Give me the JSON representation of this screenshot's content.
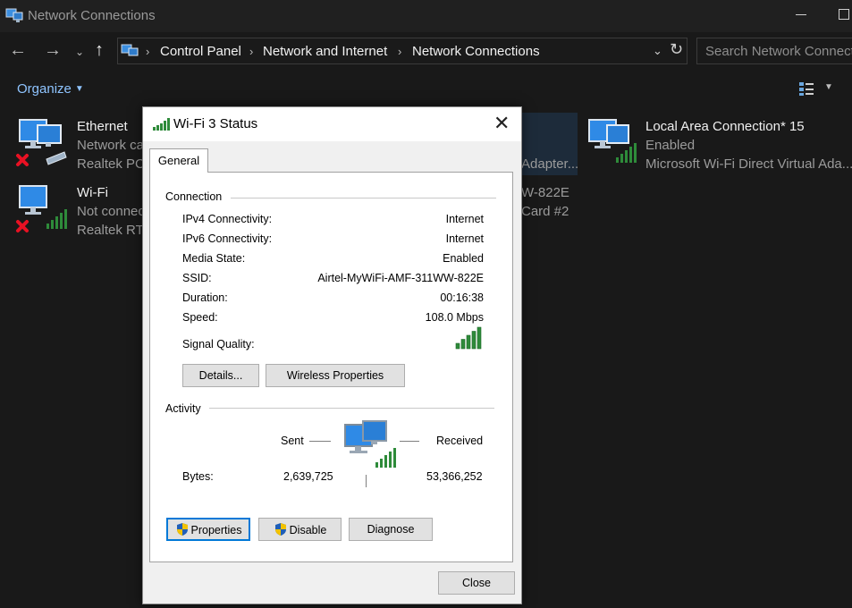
{
  "window": {
    "title": "Network Connections"
  },
  "address": {
    "crumbs": [
      "Control Panel",
      "Network and Internet",
      "Network Connections"
    ],
    "search_placeholder": "Search Network Connections"
  },
  "toolbar": {
    "organize_label": "Organize"
  },
  "connections": [
    {
      "name": "Ethernet",
      "status": "Network ca",
      "device": "Realtek PCI",
      "state": "disconnected"
    },
    {
      "name": "Wi-Fi",
      "status": "Not connec",
      "device": "Realtek RTL",
      "state": "disconnected"
    },
    {
      "name": "",
      "status": "",
      "device": "Adapter...",
      "state": "selected"
    },
    {
      "name": "",
      "status": "W-822E",
      "device": "Card #2",
      "state": "partial"
    },
    {
      "name": "Local Area Connection* 15",
      "status": "Enabled",
      "device": "Microsoft Wi-Fi Direct Virtual Ada...",
      "state": "enabled"
    }
  ],
  "dialog": {
    "title": "Wi-Fi 3 Status",
    "tab_label": "General",
    "connection_group": "Connection",
    "rows": [
      {
        "label": "IPv4 Connectivity:",
        "value": "Internet"
      },
      {
        "label": "IPv6 Connectivity:",
        "value": "Internet"
      },
      {
        "label": "Media State:",
        "value": "Enabled"
      },
      {
        "label": "SSID:",
        "value": "Airtel-MyWiFi-AMF-311WW-822E"
      },
      {
        "label": "Duration:",
        "value": "00:16:38"
      },
      {
        "label": "Speed:",
        "value": "108.0 Mbps"
      }
    ],
    "signal_label": "Signal Quality:",
    "signal_bars_lit": 5,
    "details_button": "Details...",
    "wireless_button": "Wireless Properties",
    "activity_group": "Activity",
    "sent_label": "Sent",
    "received_label": "Received",
    "bytes_label": "Bytes:",
    "bytes_sent": "2,639,725",
    "bytes_received": "53,366,252",
    "properties_button": "Properties",
    "disable_button": "Disable",
    "diagnose_button": "Diagnose",
    "close_button": "Close"
  },
  "colors": {
    "link_blue": "#8fc4ff",
    "signal_green": "#2e8b3a",
    "focus_blue": "#0078d7",
    "error_red": "#e81123"
  }
}
